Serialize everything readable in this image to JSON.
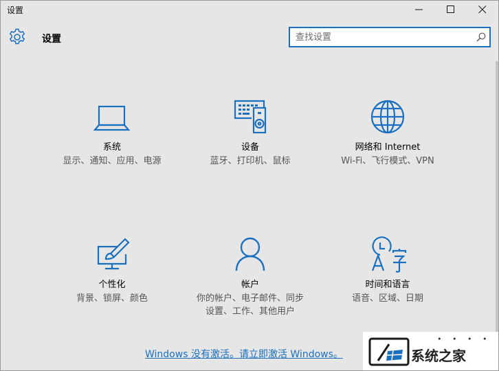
{
  "window": {
    "title": "设置"
  },
  "header": {
    "title": "设置",
    "search_placeholder": "查找设置"
  },
  "tiles": [
    {
      "name": "系统",
      "desc": "显示、通知、应用、电源",
      "icon": "laptop-icon"
    },
    {
      "name": "设备",
      "desc": "蓝牙、打印机、鼠标",
      "icon": "devices-icon"
    },
    {
      "name": "网络和 Internet",
      "desc": "Wi-Fi、飞行模式、VPN",
      "icon": "globe-icon"
    },
    {
      "name": "个性化",
      "desc": "背景、锁屏、颜色",
      "icon": "personalization-icon"
    },
    {
      "name": "帐户",
      "desc": "你的帐户、电子邮件、同步设置、工作、其他用户",
      "icon": "person-icon"
    },
    {
      "name": "时间和语言",
      "desc": "语音、区域、日期",
      "icon": "time-language-icon"
    }
  ],
  "activation": {
    "text": "Windows 没有激活。请立即激活 Windows。"
  },
  "watermark": {
    "text": "系统之家",
    "dots": "• • • •"
  },
  "colors": {
    "accent": "#1a6fbf",
    "background": "#e6e6e6"
  }
}
